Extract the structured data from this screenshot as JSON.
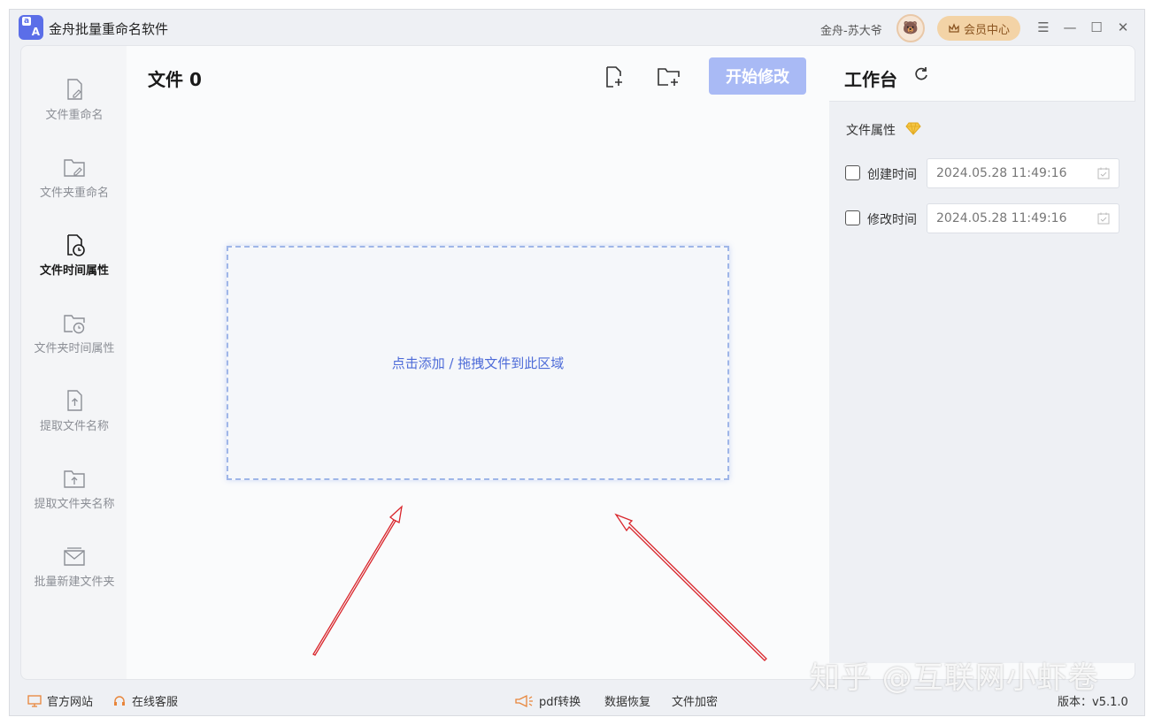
{
  "app": {
    "logo_a": "a",
    "logo_b": "A",
    "title": "金舟批量重命名软件"
  },
  "user": {
    "name": "金舟-苏大爷",
    "avatar": "🐻",
    "vip_label": "会员中心"
  },
  "window_controls": {
    "menu": "☰",
    "minimize": "—",
    "maximize": "☐",
    "close": "✕"
  },
  "sidebar": {
    "items": [
      {
        "label": "文件重命名",
        "icon": "file-edit-icon"
      },
      {
        "label": "文件夹重命名",
        "icon": "folder-edit-icon"
      },
      {
        "label": "文件时间属性",
        "icon": "file-clock-icon",
        "active": true
      },
      {
        "label": "文件夹时间属性",
        "icon": "folder-clock-icon"
      },
      {
        "label": "提取文件名称",
        "icon": "file-upload-icon"
      },
      {
        "label": "提取文件夹名称",
        "icon": "folder-upload-icon"
      },
      {
        "label": "批量新建文件夹",
        "icon": "new-folder-icon"
      }
    ]
  },
  "main": {
    "title": "文件 0",
    "start_button": "开始修改",
    "dropzone_text": "点击添加 / 拖拽文件到此区域"
  },
  "panel": {
    "title": "工作台",
    "prop_label": "文件属性",
    "rows": [
      {
        "label": "创建时间",
        "value": "2024.05.28 11:49:16",
        "checked": false
      },
      {
        "label": "修改时间",
        "value": "2024.05.28 11:49:16",
        "checked": false
      }
    ]
  },
  "status": {
    "website": "官方网站",
    "service": "在线客服",
    "pdf": "pdf转换",
    "recover": "数据恢复",
    "encrypt": "文件加密",
    "version": "版本：v5.1.0"
  },
  "watermark": "知乎 @互联网小虾卷",
  "colors": {
    "accent": "#5b6ee8",
    "start_button": "#a9baf5",
    "vip": "#f3d3a6",
    "arrow": "#d9262c"
  }
}
